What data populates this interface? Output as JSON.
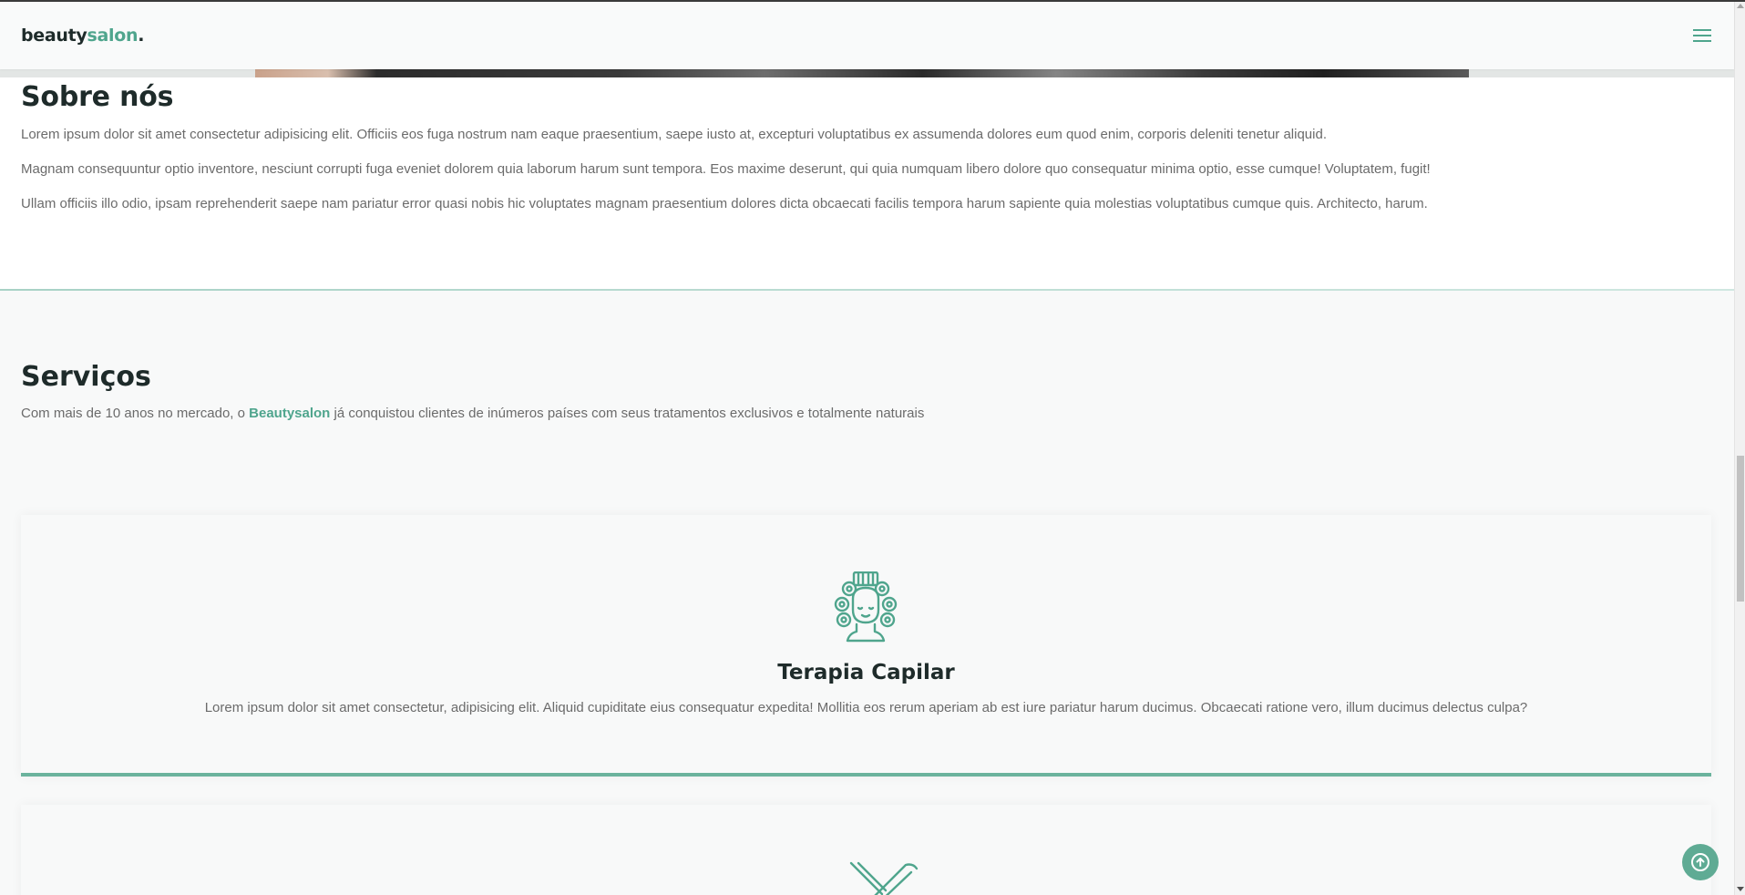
{
  "header": {
    "logo_main": "beauty",
    "logo_accent": "salon",
    "logo_dot": ".",
    "menu_icon": "hamburger-menu-icon"
  },
  "about": {
    "title": "Sobre nós",
    "paragraphs": [
      "Lorem ipsum dolor sit amet consectetur adipisicing elit. Officiis eos fuga nostrum nam eaque praesentium, saepe iusto at, excepturi voluptatibus ex assumenda dolores eum quod enim, corporis deleniti tenetur aliquid.",
      "Magnam consequuntur optio inventore, nesciunt corrupti fuga eveniet dolorem quia laborum harum sunt tempora. Eos maxime deserunt, qui quia numquam libero dolore quo consequatur minima optio, esse cumque! Voluptatem, fugit!",
      "Ullam officiis illo odio, ipsam reprehenderit saepe nam pariatur error quasi nobis hic voluptates magnam praesentium dolores dicta obcaecati facilis tempora harum sapiente quia molestias voluptatibus cumque quis. Architecto, harum."
    ]
  },
  "services": {
    "title": "Serviços",
    "lead_before": "Com mais de 10 anos no mercado, o ",
    "lead_brand": "Beautysalon",
    "lead_after": " já conquistou clientes de inúmeros países com seus tratamentos exclusivos e totalmente naturais",
    "cards": [
      {
        "icon": "hair-rollers-icon",
        "title": "Terapia Capilar",
        "text": "Lorem ipsum dolor sit amet consectetur, adipisicing elit. Aliquid cupiditate eius consequatur expedita! Mollitia eos rerum aperiam ab est iure pariatur harum ducimus. Obcaecati ratione vero, illum ducimus delectus culpa?"
      },
      {
        "icon": "scissors-icon"
      }
    ]
  },
  "back_to_top_icon": "arrow-up-circle-icon",
  "colors": {
    "accent": "#4fa58d",
    "heading": "#1e2b2a",
    "body_text": "#6b6b6b",
    "background": "#f8f9f9"
  }
}
